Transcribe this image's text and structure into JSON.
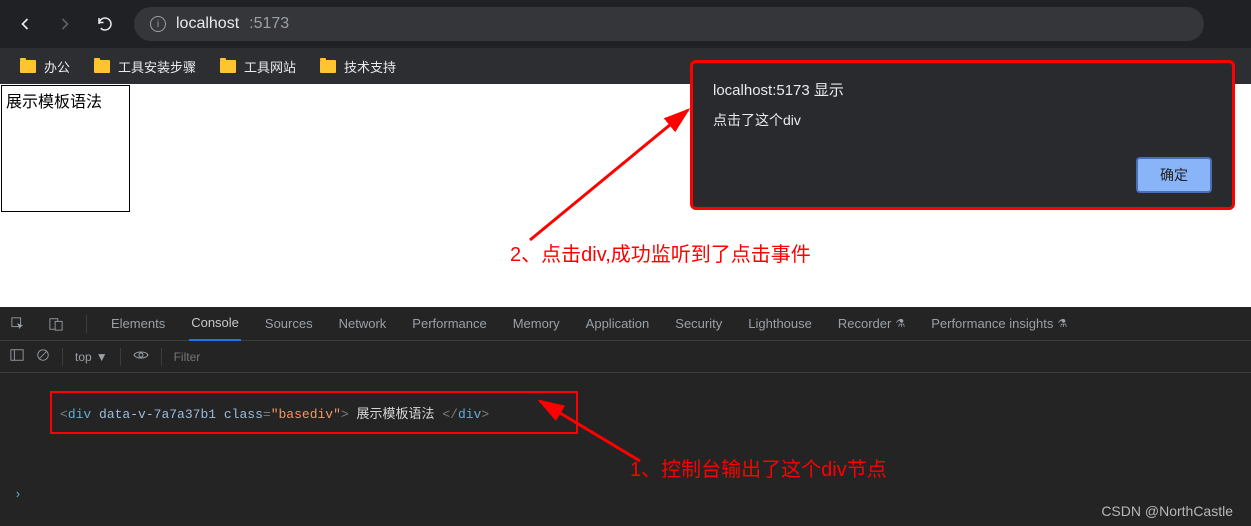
{
  "addressbar": {
    "host": "localhost",
    "port": ":5173"
  },
  "bookmarks": [
    {
      "label": "办公"
    },
    {
      "label": "工具安装步骤"
    },
    {
      "label": "工具网站"
    },
    {
      "label": "技术支持"
    }
  ],
  "page": {
    "div_text": "展示模板语法"
  },
  "alert": {
    "title": "localhost:5173 显示",
    "message": "点击了这个div",
    "ok": "确定"
  },
  "annotations": {
    "step1": "1、控制台输出了这个div节点",
    "step2": "2、点击div,成功监听到了点击事件"
  },
  "devtools": {
    "tabs": {
      "elements": "Elements",
      "console": "Console",
      "sources": "Sources",
      "network": "Network",
      "performance": "Performance",
      "memory": "Memory",
      "application": "Application",
      "security": "Security",
      "lighthouse": "Lighthouse",
      "recorder": "Recorder",
      "perf_insights": "Performance insights"
    },
    "filter": {
      "context": "top",
      "placeholder": "Filter"
    },
    "log": {
      "open": "<div ",
      "attr1_name": "data-v-7a7a37b1",
      "attr2_name": "class",
      "eq": "=",
      "attr2_val": "\"basediv\"",
      "close_open": ">",
      "text": " 展示模板语法 ",
      "close": "</div>"
    }
  },
  "watermark": "CSDN @NorthCastle"
}
